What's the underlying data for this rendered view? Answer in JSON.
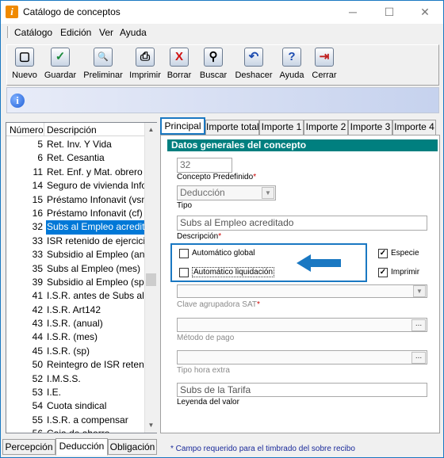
{
  "window": {
    "title": "Catálogo de conceptos",
    "minimize": "─",
    "maximize": "☐",
    "close": "✕"
  },
  "menu": [
    "Catálogo",
    "Edición",
    "Ver",
    "Ayuda"
  ],
  "toolbar": [
    {
      "label": "Nuevo",
      "icon": "new-document-icon",
      "glyph": "▢"
    },
    {
      "label": "Guardar",
      "icon": "save-check-icon",
      "glyph": "✓"
    },
    {
      "label": "Preliminar",
      "icon": "print-preview-icon",
      "glyph": "🔍"
    },
    {
      "label": "Imprimir",
      "icon": "printer-icon",
      "glyph": "⎙"
    },
    {
      "label": "Borrar",
      "icon": "delete-x-icon",
      "glyph": "X"
    },
    {
      "label": "Buscar",
      "icon": "binoculars-icon",
      "glyph": "⚲"
    },
    {
      "label": "Deshacer",
      "icon": "undo-icon",
      "glyph": "↶"
    },
    {
      "label": "Ayuda",
      "icon": "help-icon",
      "glyph": "?"
    },
    {
      "label": "Cerrar",
      "icon": "close-door-icon",
      "glyph": "⇥"
    }
  ],
  "infobar": {
    "icon": "info-icon",
    "glyph": "i"
  },
  "list": {
    "headers": {
      "number": "Número",
      "description": "Descripción"
    },
    "rows": [
      {
        "num": "5",
        "desc": "Ret. Inv. Y Vida"
      },
      {
        "num": "6",
        "desc": "Ret. Cesantia"
      },
      {
        "num": "11",
        "desc": "Ret. Enf. y Mat. obrero"
      },
      {
        "num": "14",
        "desc": "Seguro de vivienda Infonavit"
      },
      {
        "num": "15",
        "desc": "Préstamo Infonavit (vsm)"
      },
      {
        "num": "16",
        "desc": "Préstamo Infonavit (cf)"
      },
      {
        "num": "32",
        "desc": "Subs al Empleo acreditado",
        "selected": true
      },
      {
        "num": "33",
        "desc": "ISR retenido de ejercicio anterior"
      },
      {
        "num": "33",
        "desc": "Subsidio al Empleo (anual)"
      },
      {
        "num": "35",
        "desc": "Subs al Empleo (mes)"
      },
      {
        "num": "39",
        "desc": "Subsidio al Empleo (sp)"
      },
      {
        "num": "41",
        "desc": "I.S.R. antes de Subs al Empleo"
      },
      {
        "num": "42",
        "desc": "I.S.R. Art142"
      },
      {
        "num": "43",
        "desc": "I.S.R. (anual)"
      },
      {
        "num": "44",
        "desc": "I.S.R. (mes)"
      },
      {
        "num": "45",
        "desc": "I.S.R. (sp)"
      },
      {
        "num": "50",
        "desc": "Reintegro de ISR retenido"
      },
      {
        "num": "52",
        "desc": "I.M.S.S."
      },
      {
        "num": "53",
        "desc": "I.E."
      },
      {
        "num": "54",
        "desc": "Cuota sindical"
      },
      {
        "num": "55",
        "desc": "I.S.R. a compensar"
      },
      {
        "num": "56",
        "desc": "Caja de ahorro"
      }
    ]
  },
  "bottom_tabs": [
    "Percepción",
    "Deducción",
    "Obligación"
  ],
  "top_tabs": [
    "Principal",
    "Importe total",
    "Importe 1",
    "Importe 2",
    "Importe 3",
    "Importe 4"
  ],
  "form": {
    "section_title": "Datos generales del concepto",
    "concepto_value": "32",
    "concepto_label": "Concepto Predefinido",
    "required_mark": "*",
    "tipo_value": "Deducción",
    "tipo_label": "Tipo",
    "descripcion_value": "Subs al Empleo acreditado",
    "descripcion_label": "Descripción",
    "automatico_global": "Automático global",
    "automatico_liquidacion": "Automático liquidación",
    "especie": "Especie",
    "imprimir": "Imprimir",
    "clave_sat_label": "Clave agrupadora SAT",
    "metodo_pago_label": "Método de pago",
    "tipo_hora_label": "Tipo hora extra",
    "leyenda_value": "Subs de la Tarifa",
    "leyenda_label": "Leyenda del valor",
    "browse": "...",
    "check": "✓"
  },
  "status": "* Campo requerido para el timbrado del sobre recibo",
  "colors": {
    "accent": "#1a78c2",
    "section": "#007f7f",
    "selection": "#0078d7"
  }
}
